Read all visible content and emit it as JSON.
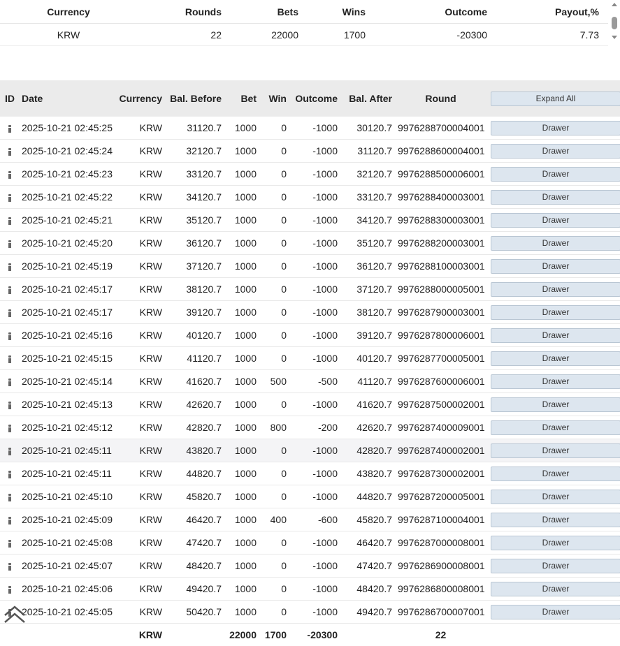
{
  "summary": {
    "headers": {
      "currency": "Currency",
      "rounds": "Rounds",
      "bets": "Bets",
      "wins": "Wins",
      "outcome": "Outcome",
      "payout": "Payout,%"
    },
    "row": {
      "currency": "KRW",
      "rounds": "22",
      "bets": "22000",
      "wins": "1700",
      "outcome": "-20300",
      "payout": "7.73"
    }
  },
  "main": {
    "headers": {
      "id": "ID",
      "date": "Date",
      "currency": "Currency",
      "bal_before": "Bal. Before",
      "bet": "Bet",
      "win": "Win",
      "outcome": "Outcome",
      "bal_after": "Bal. After",
      "round": "Round",
      "expand_all": "Expand All"
    },
    "drawer_label": "Drawer",
    "rows": [
      {
        "date": "2025-10-21 02:45:25",
        "currency": "KRW",
        "bal_before": "31120.7",
        "bet": "1000",
        "win": "0",
        "outcome": "-1000",
        "bal_after": "30120.7",
        "round": "9976288700004001",
        "drawer": "Drawer"
      },
      {
        "date": "2025-10-21 02:45:24",
        "currency": "KRW",
        "bal_before": "32120.7",
        "bet": "1000",
        "win": "0",
        "outcome": "-1000",
        "bal_after": "31120.7",
        "round": "9976288600004001",
        "drawer": "Drawer"
      },
      {
        "date": "2025-10-21 02:45:23",
        "currency": "KRW",
        "bal_before": "33120.7",
        "bet": "1000",
        "win": "0",
        "outcome": "-1000",
        "bal_after": "32120.7",
        "round": "9976288500006001",
        "drawer": "Drawer"
      },
      {
        "date": "2025-10-21 02:45:22",
        "currency": "KRW",
        "bal_before": "34120.7",
        "bet": "1000",
        "win": "0",
        "outcome": "-1000",
        "bal_after": "33120.7",
        "round": "9976288400003001",
        "drawer": "Drawer"
      },
      {
        "date": "2025-10-21 02:45:21",
        "currency": "KRW",
        "bal_before": "35120.7",
        "bet": "1000",
        "win": "0",
        "outcome": "-1000",
        "bal_after": "34120.7",
        "round": "9976288300003001",
        "drawer": "Drawer"
      },
      {
        "date": "2025-10-21 02:45:20",
        "currency": "KRW",
        "bal_before": "36120.7",
        "bet": "1000",
        "win": "0",
        "outcome": "-1000",
        "bal_after": "35120.7",
        "round": "9976288200003001",
        "drawer": "Drawer"
      },
      {
        "date": "2025-10-21 02:45:19",
        "currency": "KRW",
        "bal_before": "37120.7",
        "bet": "1000",
        "win": "0",
        "outcome": "-1000",
        "bal_after": "36120.7",
        "round": "9976288100003001",
        "drawer": "Drawer"
      },
      {
        "date": "2025-10-21 02:45:17",
        "currency": "KRW",
        "bal_before": "38120.7",
        "bet": "1000",
        "win": "0",
        "outcome": "-1000",
        "bal_after": "37120.7",
        "round": "9976288000005001",
        "drawer": "Drawer"
      },
      {
        "date": "2025-10-21 02:45:17",
        "currency": "KRW",
        "bal_before": "39120.7",
        "bet": "1000",
        "win": "0",
        "outcome": "-1000",
        "bal_after": "38120.7",
        "round": "9976287900003001",
        "drawer": "Drawer"
      },
      {
        "date": "2025-10-21 02:45:16",
        "currency": "KRW",
        "bal_before": "40120.7",
        "bet": "1000",
        "win": "0",
        "outcome": "-1000",
        "bal_after": "39120.7",
        "round": "9976287800006001",
        "drawer": "Drawer"
      },
      {
        "date": "2025-10-21 02:45:15",
        "currency": "KRW",
        "bal_before": "41120.7",
        "bet": "1000",
        "win": "0",
        "outcome": "-1000",
        "bal_after": "40120.7",
        "round": "9976287700005001",
        "drawer": "Drawer"
      },
      {
        "date": "2025-10-21 02:45:14",
        "currency": "KRW",
        "bal_before": "41620.7",
        "bet": "1000",
        "win": "500",
        "outcome": "-500",
        "bal_after": "41120.7",
        "round": "9976287600006001",
        "drawer": "Drawer"
      },
      {
        "date": "2025-10-21 02:45:13",
        "currency": "KRW",
        "bal_before": "42620.7",
        "bet": "1000",
        "win": "0",
        "outcome": "-1000",
        "bal_after": "41620.7",
        "round": "9976287500002001",
        "drawer": "Drawer"
      },
      {
        "date": "2025-10-21 02:45:12",
        "currency": "KRW",
        "bal_before": "42820.7",
        "bet": "1000",
        "win": "800",
        "outcome": "-200",
        "bal_after": "42620.7",
        "round": "9976287400009001",
        "drawer": "Drawer"
      },
      {
        "date": "2025-10-21 02:45:11",
        "currency": "KRW",
        "bal_before": "43820.7",
        "bet": "1000",
        "win": "0",
        "outcome": "-1000",
        "bal_after": "42820.7",
        "round": "9976287400002001",
        "drawer": "Drawer"
      },
      {
        "date": "2025-10-21 02:45:11",
        "currency": "KRW",
        "bal_before": "44820.7",
        "bet": "1000",
        "win": "0",
        "outcome": "-1000",
        "bal_after": "43820.7",
        "round": "9976287300002001",
        "drawer": "Drawer"
      },
      {
        "date": "2025-10-21 02:45:10",
        "currency": "KRW",
        "bal_before": "45820.7",
        "bet": "1000",
        "win": "0",
        "outcome": "-1000",
        "bal_after": "44820.7",
        "round": "9976287200005001",
        "drawer": "Drawer"
      },
      {
        "date": "2025-10-21 02:45:09",
        "currency": "KRW",
        "bal_before": "46420.7",
        "bet": "1000",
        "win": "400",
        "outcome": "-600",
        "bal_after": "45820.7",
        "round": "9976287100004001",
        "drawer": "Drawer"
      },
      {
        "date": "2025-10-21 02:45:08",
        "currency": "KRW",
        "bal_before": "47420.7",
        "bet": "1000",
        "win": "0",
        "outcome": "-1000",
        "bal_after": "46420.7",
        "round": "9976287000008001",
        "drawer": "Drawer"
      },
      {
        "date": "2025-10-21 02:45:07",
        "currency": "KRW",
        "bal_before": "48420.7",
        "bet": "1000",
        "win": "0",
        "outcome": "-1000",
        "bal_after": "47420.7",
        "round": "9976286900008001",
        "drawer": "Drawer"
      },
      {
        "date": "2025-10-21 02:45:06",
        "currency": "KRW",
        "bal_before": "49420.7",
        "bet": "1000",
        "win": "0",
        "outcome": "-1000",
        "bal_after": "48420.7",
        "round": "9976286800008001",
        "drawer": "Drawer"
      },
      {
        "date": "2025-10-21 02:45:05",
        "currency": "KRW",
        "bal_before": "50420.7",
        "bet": "1000",
        "win": "0",
        "outcome": "-1000",
        "bal_after": "49420.7",
        "round": "9976286700007001",
        "drawer": "Drawer"
      }
    ],
    "totals": {
      "currency": "KRW",
      "bet": "22000",
      "win": "1700",
      "outcome": "-20300",
      "round": "22"
    }
  },
  "icons": {
    "row_info": "info-icon",
    "scroll_top": "chevron-up-icon"
  }
}
